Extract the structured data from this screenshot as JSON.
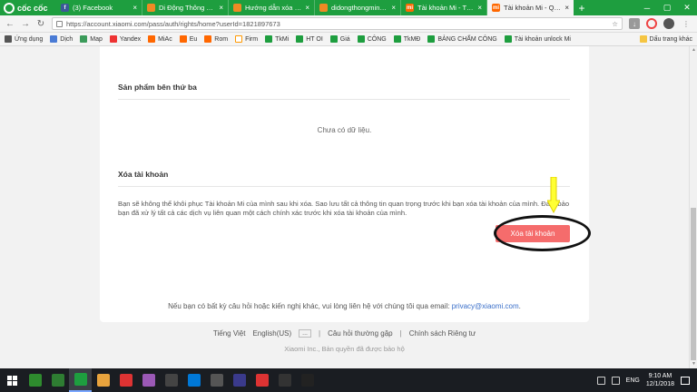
{
  "browser": {
    "brand": "cốc cốc",
    "tabs": [
      {
        "title": "(3) Facebook",
        "fav_color": "#3b5998",
        "fav_text": "f"
      },
      {
        "title": "Di Động Thông Minh",
        "fav_color": "#f08a24",
        "fav_text": ""
      },
      {
        "title": "Hướng dẫn xóa vĩnh",
        "fav_color": "#f08a24",
        "fav_text": ""
      },
      {
        "title": "didongthongminh.vn",
        "fav_color": "#f08a24",
        "fav_text": ""
      },
      {
        "title": "Tài khoản Mi - Thông",
        "fav_color": "#ff6700",
        "fav_text": "mi"
      },
      {
        "title": "Tài khoản Mi - Quyền",
        "fav_color": "#ff6700",
        "fav_text": "mi",
        "active": true
      }
    ],
    "url": "https://account.xiaomi.com/pass/auth/rights/home?userId=1821897673",
    "bookmarks": [
      {
        "label": "Ứng dụng",
        "icon": "grid"
      },
      {
        "label": "Dịch",
        "icon": "doc"
      },
      {
        "label": "Map",
        "icon": "map"
      },
      {
        "label": "Yandex",
        "icon": "y"
      },
      {
        "label": "MiAc",
        "icon": "mi"
      },
      {
        "label": "Eu",
        "icon": "mi"
      },
      {
        "label": "Rom",
        "icon": "mi"
      },
      {
        "label": "Firm",
        "icon": "firm"
      },
      {
        "label": "TkMi",
        "icon": "sheet"
      },
      {
        "label": "HT OI",
        "icon": "sheet"
      },
      {
        "label": "Giá",
        "icon": "sheet"
      },
      {
        "label": "CÔNG",
        "icon": "sheet"
      },
      {
        "label": "TkMĐ",
        "icon": "sheet"
      },
      {
        "label": "BẢNG CHẤM CÔNG",
        "icon": "sheet"
      },
      {
        "label": "Tài khoản unlock Mi",
        "icon": "sheet"
      }
    ],
    "bookmark_right": "Dấu trang khác"
  },
  "page": {
    "third_party_title": "Sản phẩm bên thứ ba",
    "empty_text": "Chưa có dữ liệu.",
    "delete_section_title": "Xóa tài khoản",
    "delete_desc": "Bạn sẽ không thể khôi phục Tài khoản Mi của mình sau khi xóa. Sao lưu tất cả thông tin quan trọng trước khi bạn xóa tài khoản của mình. Đảm bảo bạn đã xử lý tất cả các dịch vụ liên quan một cách chính xác trước khi xóa tài khoản của mình.",
    "delete_button": "Xóa tài khoản",
    "contact_text": "Nếu bạn có bất kỳ câu hỏi hoặc kiến nghị khác, vui lòng liên hệ với chúng tôi qua email:",
    "contact_email": "privacy@xiaomi.com",
    "contact_end": "."
  },
  "footer": {
    "lang_current": "Tiếng Việt",
    "lang_alt": "English(US)",
    "lang_more": "...",
    "divider": "|",
    "faq": "Câu hỏi thường gặp",
    "privacy": "Chính sách Riêng tư",
    "copyright": "Xiaomi Inc., Bản quyền đã được bảo hộ"
  },
  "taskbar": {
    "apps": [
      "#2e8b2e",
      "#2e7d32",
      "#1e9e3f",
      "#e8a33d",
      "#d33",
      "#9b59b6",
      "#444",
      "#0078d7",
      "#555",
      "#3a3a8c",
      "#d33",
      "#333",
      "#222"
    ],
    "lang": "ENG",
    "time": "9:10 AM",
    "date": "12/1/2018"
  },
  "colors": {
    "accent": "#1e9e3f",
    "danger": "#f56c6c",
    "link": "#3a6fc9"
  }
}
